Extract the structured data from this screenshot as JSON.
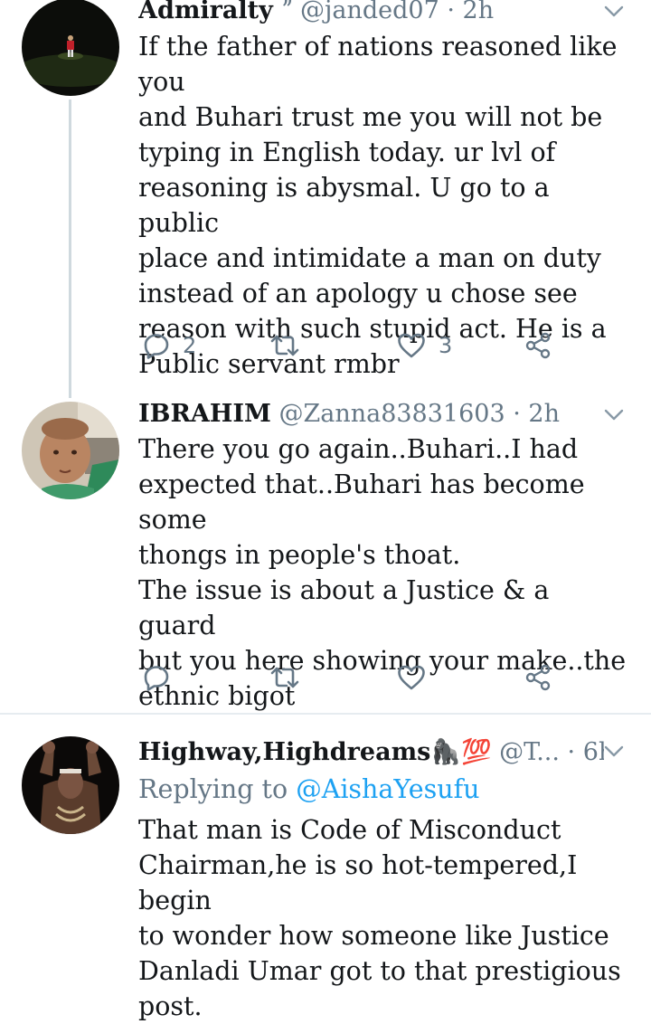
{
  "tweets": [
    {
      "name": "Admiralty",
      "name_suffix": " ˮ ",
      "handle": "@janded07",
      "dot": " · ",
      "time": "2h",
      "avatar_icon": "footballer-avatar",
      "body": "If the father of nations reasoned like you\nand Buhari trust me you will not be\ntyping in English today. ur lvl of\nreasoning is abysmal. U go to a public\nplace and intimidate a man on duty\ninstead of an apology u chose see\nreason with such stupid act. He is a\nPublic servant rmbr",
      "replies": "2",
      "retweets": "",
      "likes": "3"
    },
    {
      "name": "IBRAHIM",
      "handle": "@Zanna83831603",
      "dot": " · ",
      "time": "2h",
      "avatar_icon": "child-avatar",
      "body": "There you go again..Buhari..I had\nexpected that..Buhari has become some\nthongs in people's thoat.\nThe issue is about a  Justice & a guard\nbut you here showing your make..the\nethnic bigot",
      "replies": "",
      "retweets": "",
      "likes": ""
    },
    {
      "name": "Highway,Highdreams",
      "emoji": "🦍💯",
      "handle": " @T...",
      "dot": "  · ",
      "time": "6h",
      "avatar_icon": "raised-fists-avatar",
      "replying_prefix": "Replying to ",
      "replying_to": "@AishaYesufu",
      "body": "That man is Code of Misconduct\nChairman,he is so hot-tempered,I begin\nto wonder how someone like  Justice\nDanladi Umar got to that prestigious\npost."
    }
  ],
  "colors": {
    "text": "#14171a",
    "secondary": "#657786",
    "link": "#1da1f2",
    "divider": "#e6ecf0",
    "thread_line": "#cfd9de"
  }
}
